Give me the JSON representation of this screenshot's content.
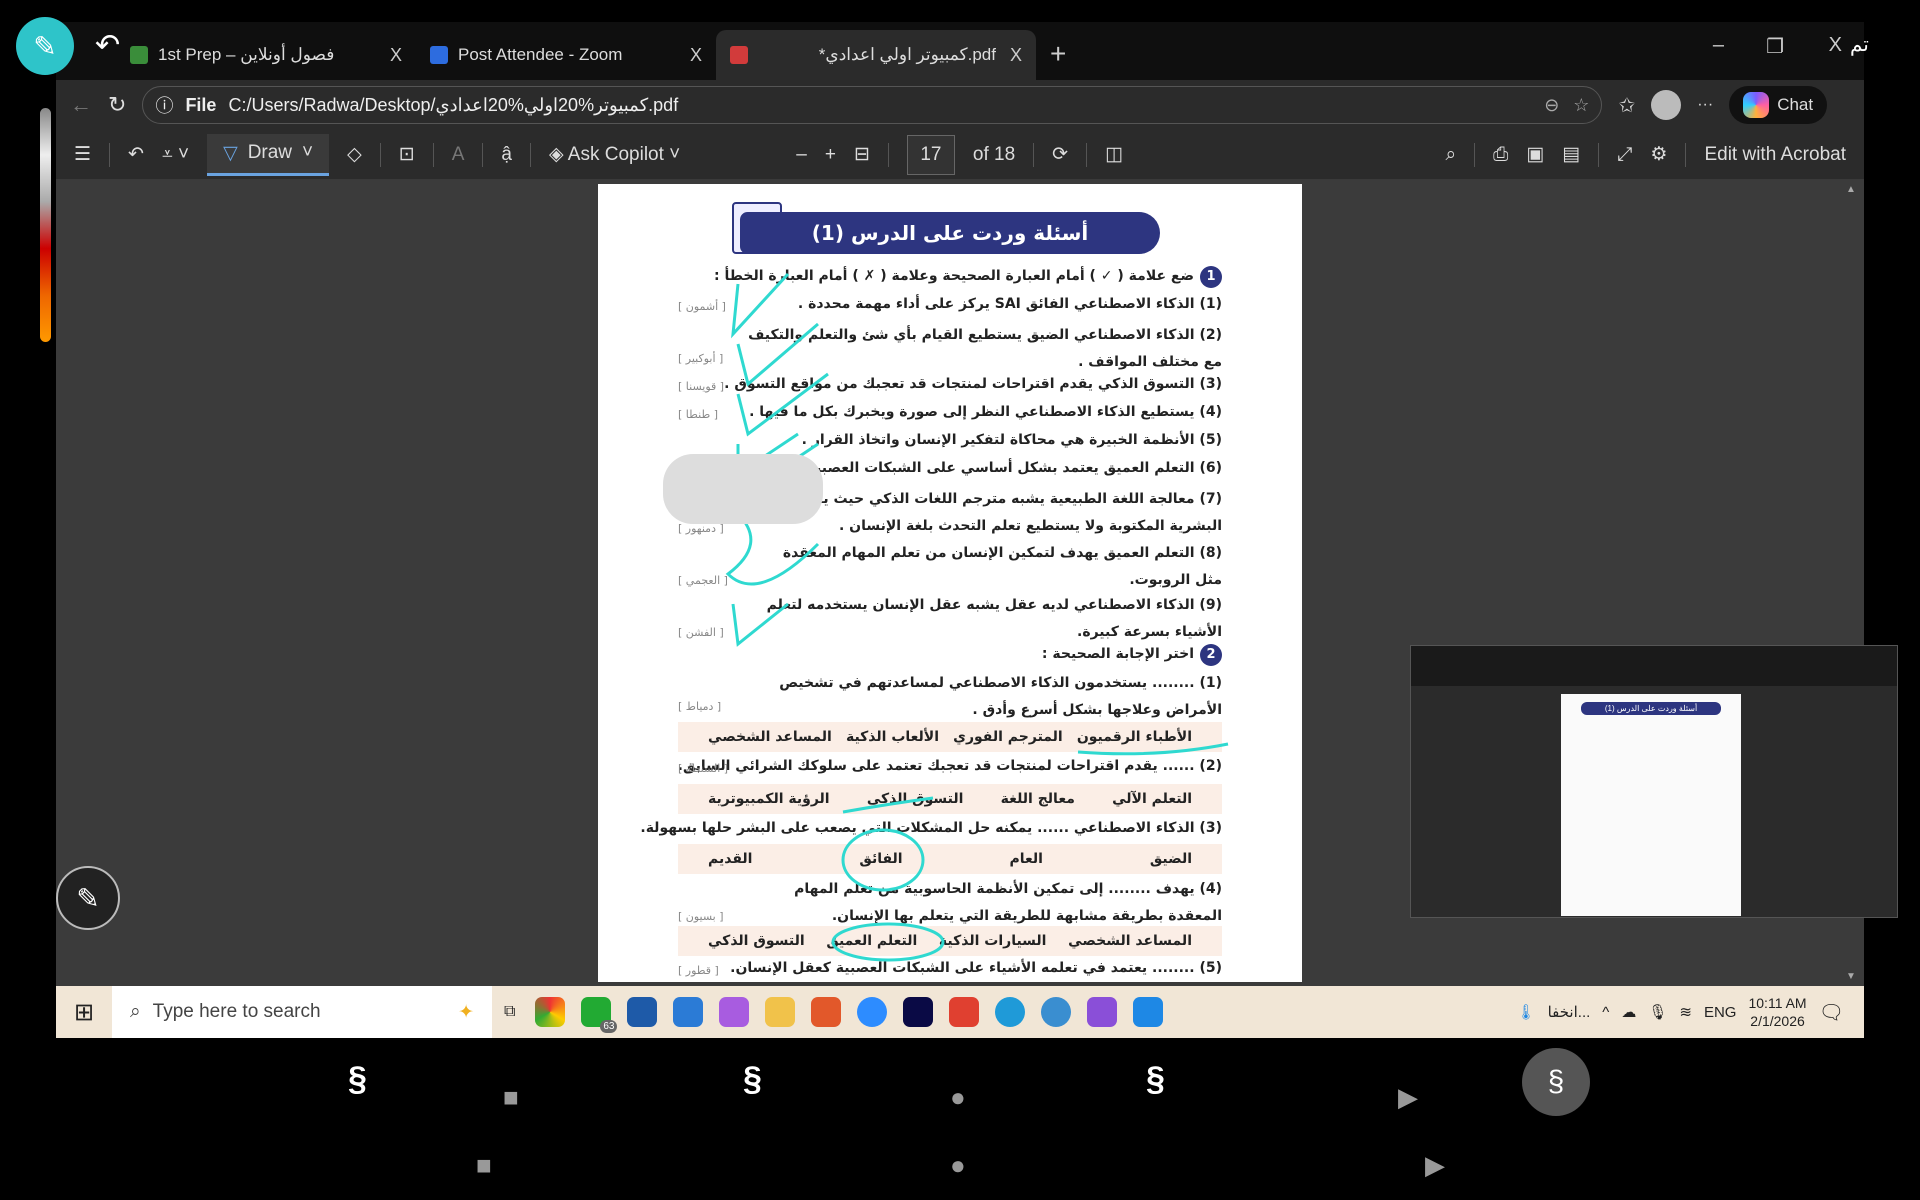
{
  "overlay": {
    "pen_label": "✎",
    "undo_label": "↶",
    "top_right_label": "تم",
    "float_pen_label": "✎"
  },
  "tabs": [
    {
      "title": "1st Prep – فصول أونلاين",
      "close": "X",
      "color": "#3a8d3a"
    },
    {
      "title": "Post Attendee - Zoom",
      "close": "X",
      "color": "#2d6cdf"
    },
    {
      "title": "*كمبيوتر اولي اعدادي.pdf",
      "close": "X",
      "color": "#d23b3b"
    }
  ],
  "new_tab": "+",
  "window_controls": {
    "minimize": "–",
    "restore": "❐",
    "close": "X"
  },
  "address_bar": {
    "scheme": "File",
    "url": "C:/Users/Radwa/Desktop/كمبيوتر%20اولي%20اعدادي.pdf",
    "chat_label": "Chat"
  },
  "pdf_toolbar": {
    "draw_label": "Draw",
    "ask_copilot": "Ask Copilot",
    "page_current": "17",
    "page_total": "of 18",
    "edit_acrobat": "Edit with Acrobat",
    "zoom_out": "–",
    "zoom_in": "+"
  },
  "pdf_page": {
    "banner_title": "أسئلة وردت على الدرس (1)",
    "section1": {
      "num": "1",
      "title": "ضع علامة ( ✓ ) أمام العبارة الصحيحة وعلامة ( ✗ ) أمام العبارة الخطأ :"
    },
    "statements": [
      {
        "text": "(1) الذكاء الاصطناعي الفائق SAI يركز على أداء مهمة محددة .",
        "source": "[ أشمون ]"
      },
      {
        "text": "(2) الذكاء الاصطناعي الضيق يستطيع القيام بأي شئ والتعلم والتكيف مع مختلف المواقف .",
        "source": "[ أبوكبير ]"
      },
      {
        "text": "(3) التسوق الذكي يقدم اقتراحات لمنتجات قد تعجبك من مواقع التسوق .",
        "source": "[ قويسنا ]"
      },
      {
        "text": "(4) يستطيع الذكاء الاصطناعي النظر إلى صورة ويخبرك بكل ما فيها .",
        "source": "[ طنطا ]"
      },
      {
        "text": "(5) الأنظمة الخبيرة هي محاكاة لتفكير الإنسان واتخاذ القرار .",
        "source": ""
      },
      {
        "text": "(6) التعلم العميق يعتمد بشكل أساسي على الشبكات العصبية .",
        "source": ""
      },
      {
        "text": "(7) معالجة اللغة الطبيعية يشبه مترجم اللغات الذكي حيث يفهم اللغه البشرية المكتوبة ولا يستطيع تعلم التحدث بلغة الإنسان .",
        "source": "[ دمنهور ]"
      },
      {
        "text": "(8) التعلم العميق يهدف لتمكين الإنسان من تعلم المهام المعقدة مثل الروبوت.",
        "source": "[ العجمي ]"
      },
      {
        "text": "(9) الذكاء الاصطناعي لديه عقل يشبه عقل الإنسان يستخدمه لتعلم الأشياء بسرعة كبيرة.",
        "source": "[ الفشن ]"
      }
    ],
    "section2": {
      "num": "2",
      "title": "اختر الإجابة الصحيحة :"
    },
    "mcq": [
      {
        "text": "(1) ........ يستخدمون الذكاء الاصطناعي لمساعدتهم في تشخيص الأمراض وعلاجها بشكل أسرع وأدق .",
        "source": "[ دمياط ]",
        "options": [
          "الأطباء الرقميون",
          "المترجم الفوري",
          "الألعاب الذكية",
          "المساعد الشخصي"
        ]
      },
      {
        "text": "(2) ...... يقدم اقتراحات لمنتجات قد تعجبك تعتمد على سلوكك الشرائي السابق.",
        "source": "[ السنطة ]",
        "options": [
          "التعلم الآلي",
          "معالج اللغة",
          "التسوق الذكي",
          "الرؤية الكمبيوترية"
        ]
      },
      {
        "text": "(3) الذكاء الاصطناعي ...... يمكنه حل المشكلات التي يصعب على البشر حلها بسهولة.",
        "source": "",
        "options": [
          "الضيق",
          "العام",
          "الفائق",
          "القديم"
        ]
      },
      {
        "text": "(4) يهدف ........ إلى تمكين الأنظمة الحاسوبية من تعلم المهام المعقدة بطريقة مشابهة للطريقة التي يتعلم بها الإنسان.",
        "source": "[ بسيون ]",
        "options": [
          "المساعد الشخصي",
          "السيارات الذكية",
          "التعلم العميق",
          "التسوق الذكي"
        ]
      },
      {
        "text": "(5) ........ يعتمد في تعلمه الأشياء على الشبكات العصبية كعقل الإنسان.",
        "source": "[ قطور ]",
        "options": []
      }
    ]
  },
  "taskbar": {
    "search_placeholder": "Type here to search",
    "tray_text": "انخفا...",
    "lang": "ENG",
    "time": "10:11 AM",
    "date": "2/1/2026",
    "whatsapp_badge": "63"
  },
  "thumbnail": {
    "title": "أسئلة وردت على الدرس (1)"
  },
  "colors": {
    "accent": "#2ec4c9",
    "banner": "#2d3580",
    "ink": "#2fd9d0"
  }
}
